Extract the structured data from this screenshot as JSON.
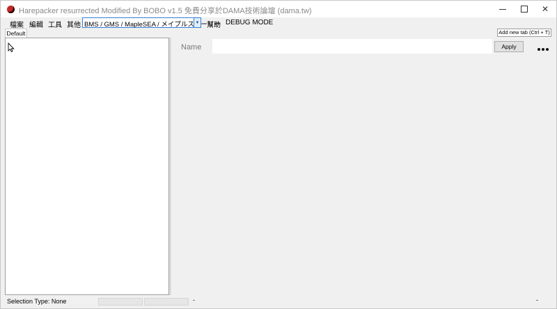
{
  "window": {
    "title": "Harepacker resurrected Modified By BOBO v1.5 免費分享於DAMA技術論壇 (dama.tw)",
    "minimize_glyph": "",
    "maximize_glyph": "",
    "close_glyph": "✕"
  },
  "menu": {
    "items": [
      "檔案",
      "編輯",
      "工具",
      "其他"
    ],
    "region_select_value": "BMS / GMS / MapleSEA / メイプルストーリー",
    "help_label": "幫助",
    "debug_label": "DEBUG MODE"
  },
  "tabs": {
    "default_tab": "Default",
    "add_tab_button": "Add new tab (Ctrl + T)"
  },
  "properties": {
    "name_label": "Name",
    "name_value": "",
    "apply_button": "Apply"
  },
  "status": {
    "selection_type": "Selection Type: None",
    "field_2": "-",
    "field_3": "-"
  },
  "icons": {
    "app": "harepacker-app-icon",
    "cursor": "mouse-pointer-icon",
    "more": "more-options-icon",
    "dropdown": "dropdown-arrow-icon"
  },
  "colors": {
    "combo_border": "#2f7fd6",
    "app_icon": "#c62828"
  }
}
